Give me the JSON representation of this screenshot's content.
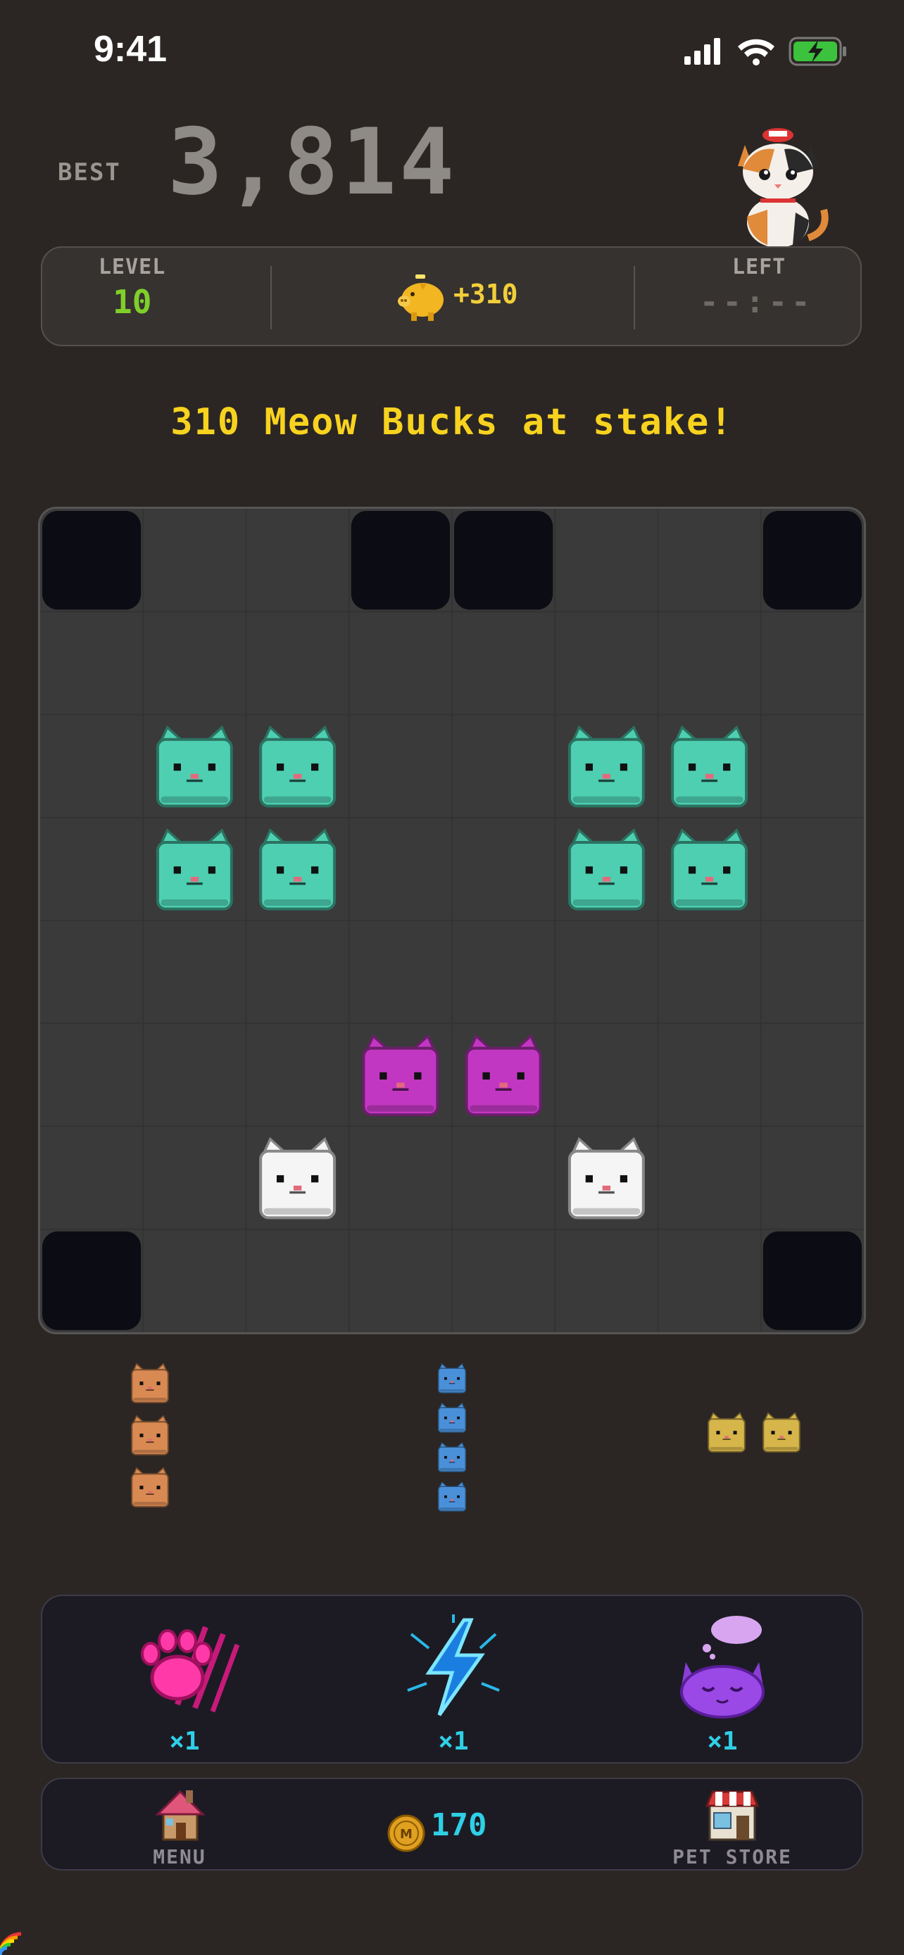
{
  "status_bar": {
    "time": "9:41",
    "icons": [
      "cellular-signal-icon",
      "wifi-icon",
      "battery-charging-icon"
    ],
    "battery_color": "#3cc23c"
  },
  "header": {
    "best_label": "BEST",
    "best_score": "3,814",
    "mascot": "calico-cat-mascot-icon"
  },
  "stats": {
    "level_label": "LEVEL",
    "level_value": "10",
    "bonus_icon": "golden-piggy-bank-icon",
    "bonus_value": "+310",
    "left_label": "LEFT",
    "left_value": "--:--"
  },
  "banner": {
    "text": "310 Meow Bucks at stake!"
  },
  "board": {
    "columns": 8,
    "rows": 8,
    "blocked_cells": [
      [
        0,
        0
      ],
      [
        0,
        3
      ],
      [
        0,
        4
      ],
      [
        0,
        7
      ],
      [
        7,
        0
      ],
      [
        7,
        7
      ]
    ],
    "cats": [
      {
        "row": 2,
        "col": 1,
        "color": "teal"
      },
      {
        "row": 2,
        "col": 2,
        "color": "teal"
      },
      {
        "row": 2,
        "col": 5,
        "color": "teal"
      },
      {
        "row": 2,
        "col": 6,
        "color": "teal"
      },
      {
        "row": 3,
        "col": 1,
        "color": "teal"
      },
      {
        "row": 3,
        "col": 2,
        "color": "teal"
      },
      {
        "row": 3,
        "col": 5,
        "color": "teal"
      },
      {
        "row": 3,
        "col": 6,
        "color": "teal"
      },
      {
        "row": 5,
        "col": 3,
        "color": "magenta"
      },
      {
        "row": 5,
        "col": 4,
        "color": "magenta"
      },
      {
        "row": 6,
        "col": 2,
        "color": "white"
      },
      {
        "row": 6,
        "col": 5,
        "color": "white"
      }
    ],
    "palette": {
      "teal": "#4ecfb1",
      "magenta": "#c237c2",
      "white": "#f5f5f5",
      "orange": "#d98a52",
      "blue": "#4a90d9",
      "yellow": "#d6b54a",
      "blocked": "#0c0c14",
      "cell": "#3a3a3a"
    }
  },
  "tray": {
    "pieces": [
      {
        "name": "tray-piece-orange",
        "color": "orange",
        "cells": [
          [
            0,
            0
          ],
          [
            1,
            0
          ],
          [
            2,
            0
          ]
        ]
      },
      {
        "name": "tray-piece-blue",
        "color": "blue",
        "cells": [
          [
            0,
            0
          ],
          [
            1,
            0
          ],
          [
            2,
            0
          ],
          [
            3,
            0
          ]
        ]
      },
      {
        "name": "tray-piece-yellow",
        "color": "yellow",
        "cells": [
          [
            0,
            0
          ],
          [
            0,
            1
          ]
        ]
      }
    ]
  },
  "powerups": [
    {
      "name": "claw-powerup",
      "icon": "pink-paw-claw-icon",
      "count": "×1"
    },
    {
      "name": "lightning-powerup",
      "icon": "blue-lightning-bolt-icon",
      "count": "×1"
    },
    {
      "name": "dream-powerup",
      "icon": "sleeping-purple-cat-icon",
      "count": "×1"
    }
  ],
  "bottom_nav": {
    "menu_label": "MENU",
    "menu_icon": "cottage-house-icon",
    "coin_icon": "meow-coin-icon",
    "coin_balance": "170",
    "store_label": "PET STORE",
    "store_icon": "pet-store-shop-icon"
  }
}
